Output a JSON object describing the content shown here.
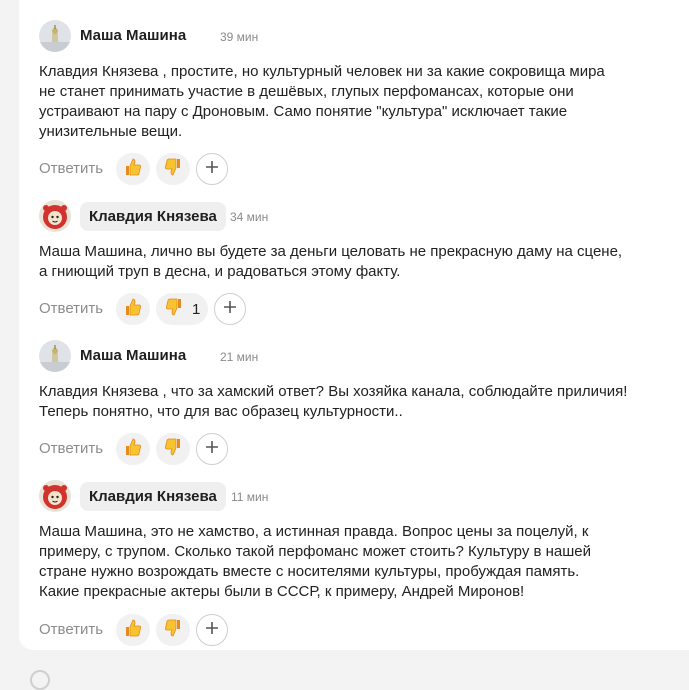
{
  "comments": [
    {
      "author": "Маша Машина",
      "time": "39 мин",
      "avatar": "church-dome-photo",
      "lines": [
        "Клавдия Князева , простите, но культурный человек ни за какие сокровища мира",
        "не станет принимать участие в дешёвых, глупых перфомансах, которые они",
        "устраивают на пару с Дроновым. Само понятие \"культура\" исключает такие",
        "унизительные вещи."
      ],
      "reply": "Ответить",
      "dislikes": ""
    },
    {
      "author": "Клавдия Князева",
      "time": "34 мин",
      "avatar": "red-cartoon-character",
      "lines": [
        "Маша Машина, лично вы будете за деньги целовать не прекрасную даму на сцене,",
        "а гниющий труп в десна, и радоваться этому факту."
      ],
      "reply": "Ответить",
      "dislikes": "1"
    },
    {
      "author": "Маша Машина",
      "time": "21 мин",
      "avatar": "church-dome-photo",
      "lines": [
        "Клавдия Князева , что за хамский ответ? Вы хозяйка канала, соблюдайте приличия!",
        "Теперь понятно, что для вас образец культурности.."
      ],
      "reply": "Ответить",
      "dislikes": ""
    },
    {
      "author": "Клавдия Князева",
      "time": "11 мин",
      "avatar": "red-cartoon-character",
      "lines": [
        "Маша Машина, это не хамство, а истинная правда. Вопрос цены за поцелуй, к",
        "примеру, с трупом. Сколько такой перфоманс может стоить? Культуру в нашей",
        "стране нужно возрождать вместе с носителями культуры, пробуждая память.",
        "Какие прекрасные актеры были в СССР, к примеру, Андрей Миронов!"
      ],
      "reply": "Ответить",
      "dislikes": ""
    }
  ],
  "icons": {
    "like": "thumbs-up-icon",
    "dislike": "thumbs-down-icon",
    "add_reaction": "plus-icon"
  },
  "colors": {
    "emoji_yellow": "#f7c32e",
    "emoji_orange": "#e8891c",
    "author_pill": "#efefef",
    "meta_gray": "#8a8a8a"
  }
}
